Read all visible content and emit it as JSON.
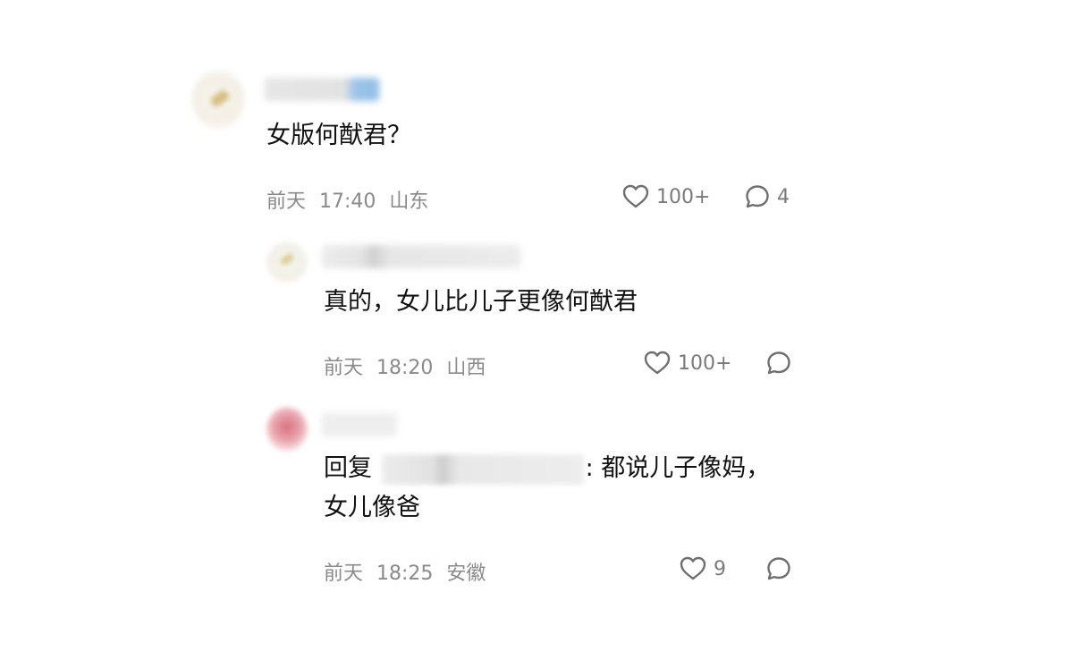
{
  "comments": [
    {
      "text": "女版何猷君？",
      "meta": {
        "day": "前天",
        "time": "17:40",
        "location": "山东"
      },
      "likes": "100+",
      "replies": "4"
    },
    {
      "text": "真的，女儿比儿子更像何猷君",
      "meta": {
        "day": "前天",
        "time": "18:20",
        "location": "山西"
      },
      "likes": "100+",
      "replies": ""
    },
    {
      "reply_prefix": "回复",
      "text_after_mention": ": 都说儿子像妈，",
      "text_line2": "女儿像爸",
      "meta": {
        "day": "前天",
        "time": "18:25",
        "location": "安徽"
      },
      "likes": "9",
      "replies": ""
    }
  ],
  "icons": {
    "like": "heart-outline-icon",
    "reply": "speech-bubble-icon"
  },
  "colors": {
    "text": "#111111",
    "meta": "#8a8a8a",
    "icon": "#7a7a7a",
    "background": "#ffffff"
  }
}
